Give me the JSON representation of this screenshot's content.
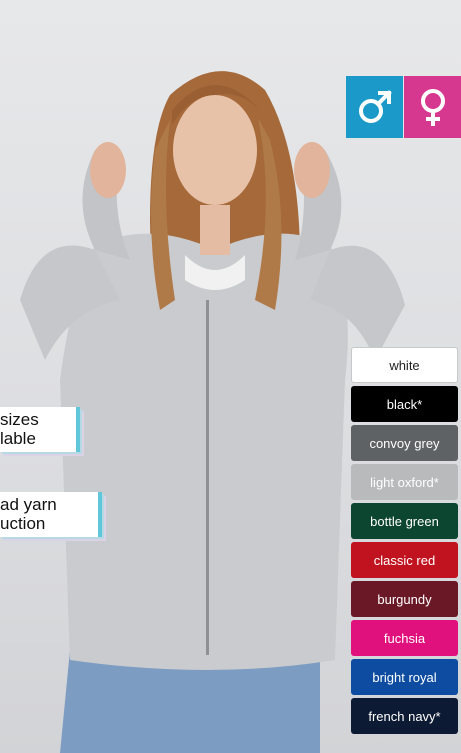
{
  "badges": [
    {
      "line1": "sizes",
      "line2": "lable"
    },
    {
      "line1": "ad yarn",
      "line2": "uction"
    }
  ],
  "swatches": [
    {
      "label": "white",
      "color": "#ffffff"
    },
    {
      "label": "black*",
      "color": "#000000"
    },
    {
      "label": "convoy grey",
      "color": "#5f6265"
    },
    {
      "label": "light oxford*",
      "color": "#b9babc"
    },
    {
      "label": "bottle green",
      "color": "#0c4530"
    },
    {
      "label": "classic red",
      "color": "#c1121f"
    },
    {
      "label": "burgundy",
      "color": "#6b1826"
    },
    {
      "label": "fuchsia",
      "color": "#e0107d"
    },
    {
      "label": "bright royal",
      "color": "#0d4ca0"
    },
    {
      "label": "french navy*",
      "color": "#0d1a33"
    }
  ],
  "icons": {
    "male": "male-symbol-icon",
    "female": "female-symbol-icon"
  },
  "accent": {
    "male": "#1b9ac9",
    "female": "#d6378f"
  }
}
